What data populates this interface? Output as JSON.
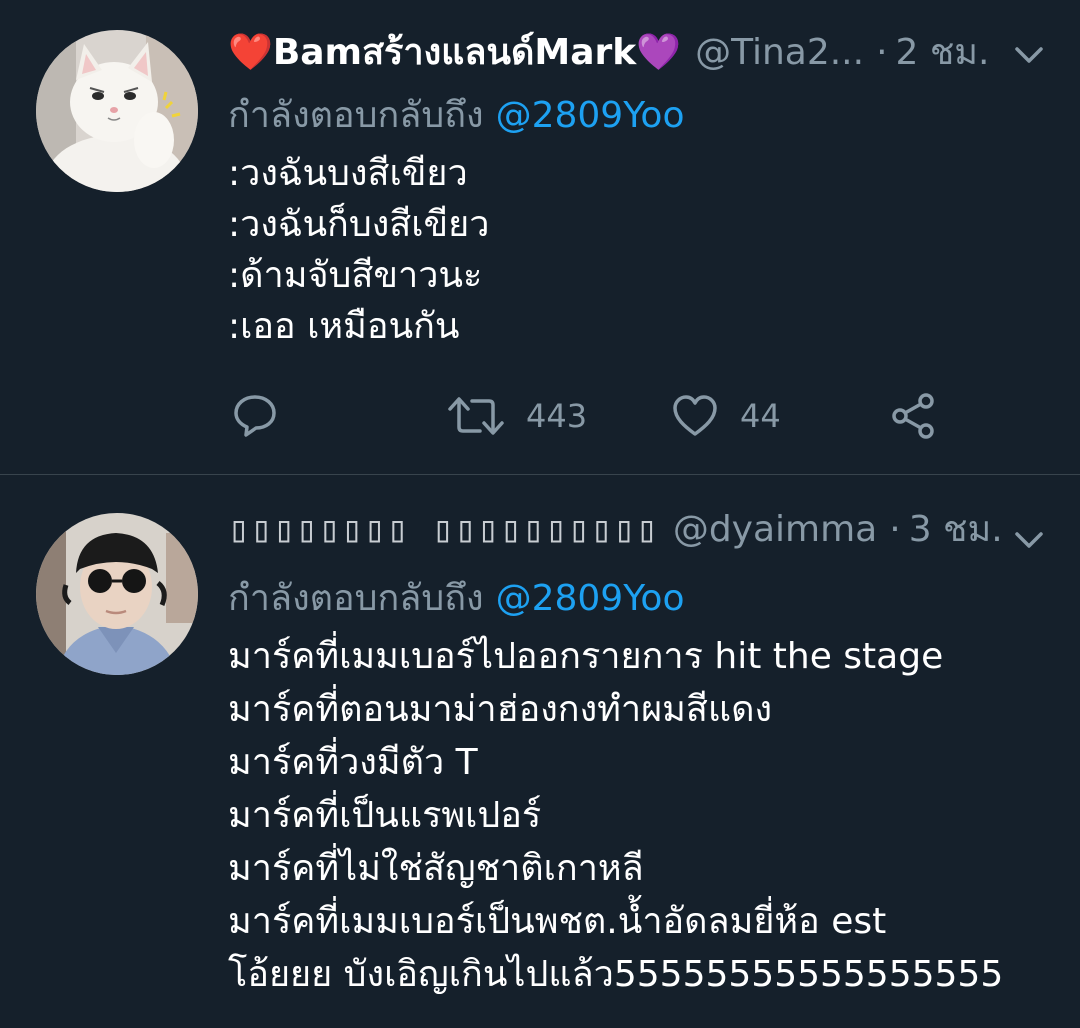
{
  "tweets": [
    {
      "display_name": "❤️Bamสร้างแลนด์Mark💜",
      "handle": "@Tina2...",
      "separator": "·",
      "time": "2 ชม.",
      "reply_prefix": "กำลังตอบกลับถึง",
      "reply_to": "@2809Yoo",
      "lines": [
        ":วงฉันบงสีเขียว",
        ":วงฉันก็บงสีเขียว",
        ":ด้ามจับสีขาวนะ",
        ":เออ เหมือนกัน"
      ],
      "retweet_count": "443",
      "like_count": "44",
      "avatar": "white-cat-photo"
    },
    {
      "display_name": "▯▯▯▯▯▯▯▯ ▯▯▯▯▯▯▯▯▯▯",
      "handle": "@dyaimma",
      "separator": "·",
      "time": "3 ชม.",
      "reply_prefix": "กำลังตอบกลับถึง",
      "reply_to": "@2809Yoo",
      "lines": [
        "มาร์คที่เมมเบอร์ไปออกรายการ hit the stage",
        "มาร์คที่ตอนมาม่าฮ่องกงทำผมสีแดง",
        "มาร์คที่วงมีตัว T",
        "มาร์คที่เป็นแรพเปอร์",
        "มาร์คที่ไม่ใช่สัญชาติเกาหลี",
        "มาร์คที่เมมเบอร์เป็นพชต.น้ำอัดลมยี่ห้อ est",
        "โอ้ยยย บังเอิญเกินไปแล้ว55555555555555555"
      ],
      "avatar": "person-with-sunglasses-photo"
    }
  ],
  "icons": {
    "reply": "reply-icon",
    "retweet": "retweet-icon",
    "like": "heart-icon",
    "share": "share-icon",
    "menu": "chevron-down-icon"
  },
  "colors": {
    "background": "#15202b",
    "text": "#ffffff",
    "muted": "#8899a6",
    "link": "#1da1f2",
    "divider": "#38444d"
  }
}
